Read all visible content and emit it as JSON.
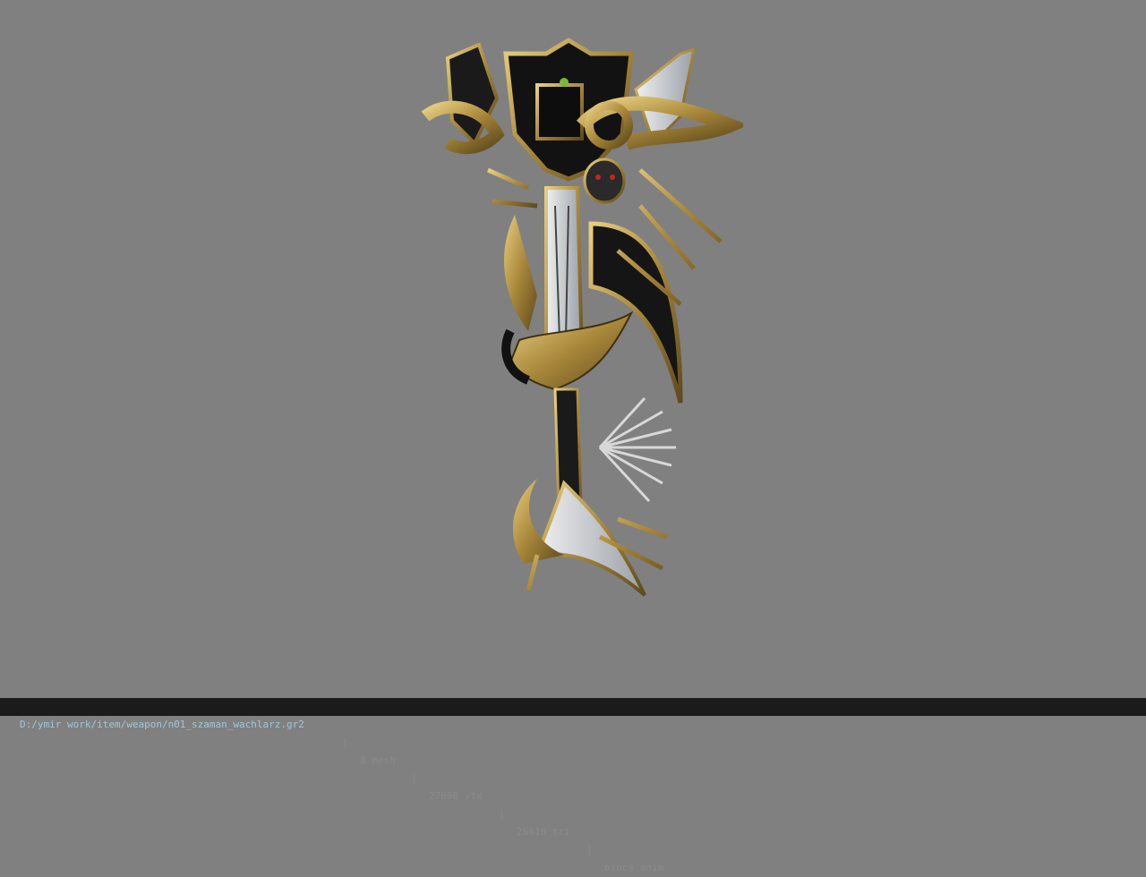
{
  "viewer": {
    "background_color": "#808080",
    "model_icon": "ornate-golden-fan-weapon-model"
  },
  "statusbar": {
    "path": "D:/ymir work/item/weapon/n01_szaman_wachlarz.gr2",
    "separator": "|",
    "mesh": "8 mesh",
    "vtx": "27898 vtx",
    "tri": "26616 tri",
    "anim": "nincs anim"
  }
}
